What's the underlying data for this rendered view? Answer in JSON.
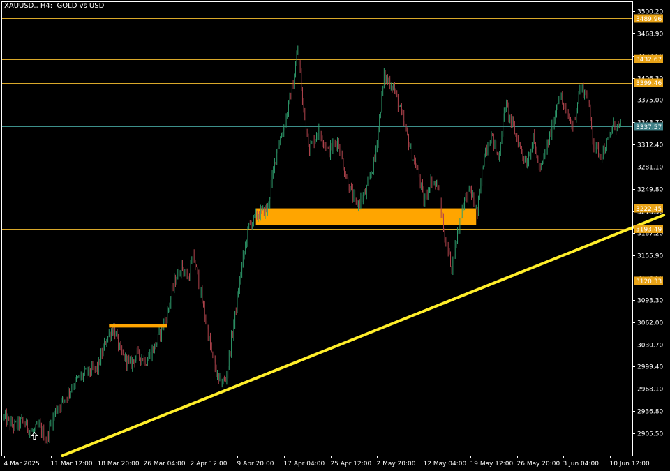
{
  "window": {
    "title": "XAUUSD., H4:  GOLD vs USD"
  },
  "colors": {
    "background": "#000000",
    "frame": "#ffffff",
    "bull": "#2f9e6e",
    "bear": "#b2444d",
    "level_line": "#d9a82a",
    "level_label": "#e8a317",
    "current_line": "#3d8f8a",
    "current_label": "#3e7f86",
    "zone": "#ffa500",
    "trendline": "#ffee2a"
  },
  "chart_data": {
    "type": "candlestick",
    "symbol": "XAUUSD.",
    "timeframe": "H4",
    "description": "GOLD vs USD",
    "y_ticks": [
      3500.2,
      3468.9,
      3437.6,
      3406.3,
      3375.0,
      3343.7,
      3312.4,
      3281.1,
      3249.8,
      3218.5,
      3187.2,
      3155.9,
      3124.6,
      3093.3,
      3062.0,
      3030.7,
      2999.4,
      2968.1,
      2936.8,
      2905.5
    ],
    "y_tick_labels": [
      "3500.20",
      "3468.90",
      "3437.60",
      "3406.30",
      "3375.00",
      "3343.70",
      "3312.40",
      "3281.10",
      "3249.80",
      "3218.50",
      "3187.20",
      "3155.90",
      "3124.60",
      "3093.30",
      "3062.00",
      "3030.70",
      "2999.40",
      "2968.10",
      "2936.80",
      "2905.50"
    ],
    "ylim": [
      2874.0,
      3514.0
    ],
    "x_tick_labels": [
      "4 Mar 2025",
      "11 Mar 12:00",
      "18 Mar 20:00",
      "26 Mar 04:00",
      "2 Apr 12:00",
      "9 Apr 20:00",
      "17 Apr 04:00",
      "25 Apr 12:00",
      "2 May 20:00",
      "12 May 04:00",
      "19 May 12:00",
      "26 May 20:00",
      "3 Jun 04:00",
      "10 Jun 12:00"
    ],
    "x_tick_index": [
      0,
      40,
      80,
      120,
      160,
      200,
      240,
      280,
      320,
      360,
      400,
      440,
      480,
      520
    ],
    "bar_count": 530,
    "bar_anchors": [
      [
        0,
        2928
      ],
      [
        8,
        2915
      ],
      [
        16,
        2923
      ],
      [
        24,
        2906
      ],
      [
        30,
        2915
      ],
      [
        36,
        2896
      ],
      [
        44,
        2938
      ],
      [
        54,
        2960
      ],
      [
        62,
        2980
      ],
      [
        70,
        2990
      ],
      [
        80,
        2997
      ],
      [
        88,
        3040
      ],
      [
        94,
        3054
      ],
      [
        100,
        3018
      ],
      [
        108,
        3002
      ],
      [
        114,
        3016
      ],
      [
        122,
        3008
      ],
      [
        130,
        3030
      ],
      [
        140,
        3075
      ],
      [
        146,
        3118
      ],
      [
        152,
        3142
      ],
      [
        158,
        3123
      ],
      [
        162,
        3155
      ],
      [
        166,
        3128
      ],
      [
        172,
        3072
      ],
      [
        178,
        3018
      ],
      [
        184,
        2977
      ],
      [
        190,
        2980
      ],
      [
        196,
        3048
      ],
      [
        204,
        3142
      ],
      [
        210,
        3198
      ],
      [
        218,
        3214
      ],
      [
        226,
        3222
      ],
      [
        234,
        3306
      ],
      [
        240,
        3336
      ],
      [
        248,
        3398
      ],
      [
        252,
        3448
      ],
      [
        256,
        3372
      ],
      [
        262,
        3306
      ],
      [
        270,
        3334
      ],
      [
        278,
        3302
      ],
      [
        286,
        3318
      ],
      [
        294,
        3262
      ],
      [
        302,
        3226
      ],
      [
        310,
        3244
      ],
      [
        318,
        3292
      ],
      [
        326,
        3408
      ],
      [
        334,
        3394
      ],
      [
        342,
        3348
      ],
      [
        350,
        3298
      ],
      [
        356,
        3268
      ],
      [
        360,
        3232
      ],
      [
        366,
        3260
      ],
      [
        372,
        3254
      ],
      [
        378,
        3182
      ],
      [
        384,
        3140
      ],
      [
        388,
        3178
      ],
      [
        394,
        3232
      ],
      [
        400,
        3248
      ],
      [
        406,
        3214
      ],
      [
        412,
        3302
      ],
      [
        418,
        3326
      ],
      [
        424,
        3292
      ],
      [
        430,
        3370
      ],
      [
        436,
        3340
      ],
      [
        442,
        3312
      ],
      [
        448,
        3286
      ],
      [
        454,
        3320
      ],
      [
        460,
        3274
      ],
      [
        466,
        3310
      ],
      [
        472,
        3348
      ],
      [
        476,
        3384
      ],
      [
        482,
        3358
      ],
      [
        488,
        3338
      ],
      [
        494,
        3392
      ],
      [
        500,
        3384
      ],
      [
        506,
        3312
      ],
      [
        512,
        3298
      ],
      [
        518,
        3316
      ],
      [
        522,
        3338
      ]
    ],
    "price_levels": [
      {
        "price": 3489.96,
        "label": "3489.96"
      },
      {
        "price": 3432.67,
        "label": "3432.67"
      },
      {
        "price": 3399.46,
        "label": "3399.46"
      },
      {
        "price": 3222.45,
        "label": "3222.45"
      },
      {
        "price": 3193.49,
        "label": "3193.49"
      },
      {
        "price": 3120.33,
        "label": "3120.33"
      }
    ],
    "current_price": {
      "price": 3337.57,
      "label": "3337.57"
    },
    "zones": [
      {
        "from_bar": 216,
        "to_bar": 405,
        "price_high": 3222.45,
        "price_low": 3199.0
      }
    ],
    "resistance_segments": [
      {
        "from_bar": 90,
        "to_bar": 140,
        "price": 3057.0
      }
    ],
    "trendline": {
      "from_bar": 50,
      "from_price": 2874.0,
      "to_bar": 566,
      "to_price": 3213.0
    },
    "arrow_marker": {
      "bar": 26,
      "price": 2902.0,
      "icon": "up-arrow-icon"
    },
    "grid": false
  }
}
